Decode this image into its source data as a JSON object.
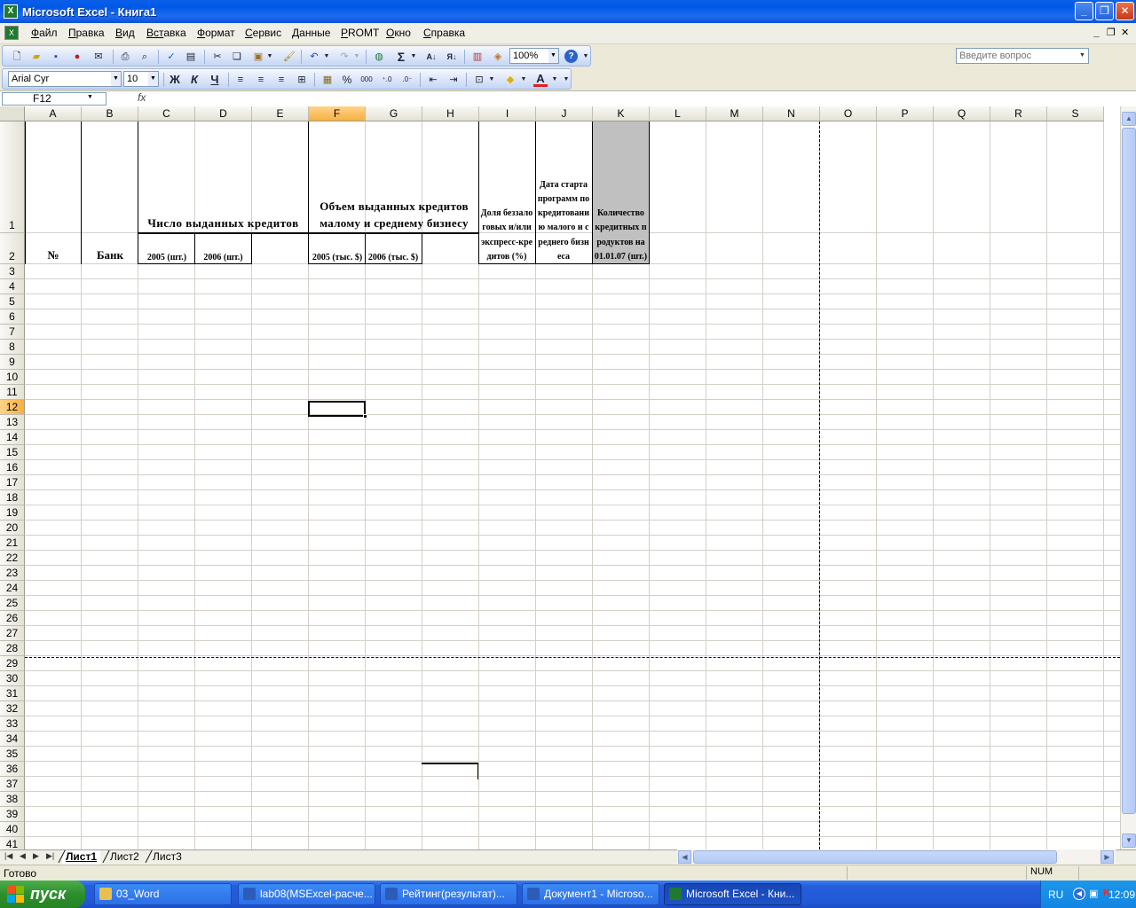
{
  "window": {
    "title": "Microsoft Excel - Книга1",
    "minimize": "_",
    "restore": "❐",
    "close": "✕"
  },
  "menu": {
    "items": [
      {
        "u": "Ф",
        "rest": "айл"
      },
      {
        "u": "П",
        "rest": "равка"
      },
      {
        "u": "В",
        "rest": "ид"
      },
      {
        "u": "Вст",
        "rest": "авка"
      },
      {
        "u": "Ф",
        "rest": "ормат"
      },
      {
        "u": "С",
        "rest": "ервис"
      },
      {
        "u": "Д",
        "rest": "анные"
      },
      {
        "u": "P",
        "rest": "ROMT"
      },
      {
        "u": "О",
        "rest": "кно"
      },
      {
        "u": "С",
        "rest": "правка"
      }
    ],
    "help_placeholder": "Введите вопрос",
    "doc_min": "_",
    "doc_restore": "❐",
    "doc_close": "✕"
  },
  "toolbar": {
    "zoom": "100%",
    "sum": "Σ"
  },
  "format_toolbar": {
    "font": "Arial Cyr",
    "size": "10",
    "bold": "Ж",
    "italic": "К",
    "underline": "Ч",
    "percent": "%",
    "thousands": "000"
  },
  "formula_bar": {
    "name_box": "F12",
    "fx": "fx",
    "content": ""
  },
  "grid": {
    "columns": [
      "A",
      "B",
      "C",
      "D",
      "E",
      "F",
      "G",
      "H",
      "I",
      "J",
      "K",
      "L",
      "M",
      "N",
      "O",
      "P",
      "Q",
      "R",
      "S"
    ],
    "selected_column": "F",
    "selected_row": "12",
    "rows": [
      "1",
      "2",
      "3",
      "4",
      "5",
      "6",
      "7",
      "8",
      "9",
      "10",
      "11",
      "12",
      "13",
      "14",
      "15",
      "16",
      "17",
      "18",
      "19",
      "20",
      "21",
      "22",
      "23",
      "24",
      "25",
      "26",
      "27",
      "28",
      "29",
      "30",
      "31",
      "32",
      "33",
      "34",
      "35",
      "36",
      "37",
      "38",
      "39",
      "40",
      "41"
    ]
  },
  "cells": {
    "A2": "№",
    "B2": "Банк",
    "C1": "Число выданных кредитов",
    "C2": "2005 (шт.)",
    "D2": "2006 (шт.)",
    "F1": "Объем выданных кредитов малому и среднему бизнесу",
    "F2": "2005 (тыс. $)",
    "G2": "2006 (тыс. $)",
    "I1": "Доля беззалоговых и/или экспресс-кредитов (%)",
    "J1": "Дата старта программ по кредитованию малого и среднего бизнеса",
    "K1": "Количество кредитных продуктов на 01.01.07 (шт.)"
  },
  "sheet_tabs": {
    "tabs": [
      "Лист1",
      "Лист2",
      "Лист3"
    ],
    "active": "Лист1"
  },
  "status": {
    "text": "Готово",
    "num": "NUM"
  },
  "taskbar": {
    "start": "пуск",
    "tasks": [
      {
        "label": "03_Word",
        "color": "#E8C050"
      },
      {
        "label": "lab08(MSExcel-расче...",
        "color": "#2B5CB8"
      },
      {
        "label": "Рейтинг(результат)...",
        "color": "#2B5CB8"
      },
      {
        "label": "Документ1 - Microso...",
        "color": "#2B5CB8"
      },
      {
        "label": "Microsoft Excel - Кни...",
        "color": "#1F7A2E"
      }
    ],
    "active_task": 4,
    "lang": "RU",
    "clock": "12:09"
  },
  "colors": {
    "selected_header": "#F8B040",
    "k_column_fill": "#C0C0C0",
    "title_bar": "#0058E6",
    "taskbar": "#245EDB"
  }
}
